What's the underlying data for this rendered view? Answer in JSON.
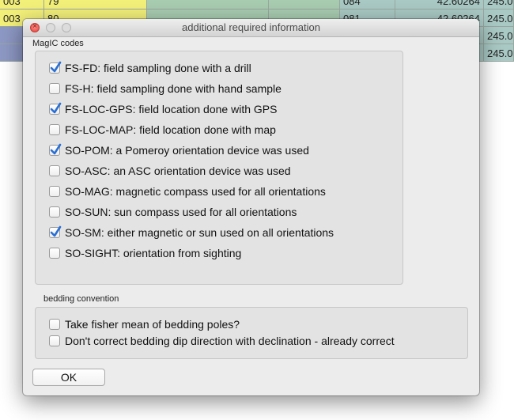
{
  "background_table": {
    "rows": [
      [
        "003",
        "79",
        "",
        "",
        "084",
        "42.60264",
        "245.0"
      ],
      [
        "003",
        "80",
        "",
        "",
        "081",
        "42.60264",
        "245.0"
      ],
      [
        "",
        "",
        "",
        "",
        "",
        "",
        "245.0"
      ],
      [
        "",
        "",
        "",
        "",
        "",
        "",
        "245.0"
      ]
    ]
  },
  "dialog": {
    "title": "additional required information",
    "magic_codes": {
      "legend": "MagIC codes",
      "options": [
        {
          "label": "FS-FD: field sampling done with a drill",
          "checked": true
        },
        {
          "label": "FS-H: field sampling done with hand sample",
          "checked": false
        },
        {
          "label": "FS-LOC-GPS: field location done with GPS",
          "checked": true
        },
        {
          "label": "FS-LOC-MAP:  field location done with map",
          "checked": false
        },
        {
          "label": "SO-POM:  a Pomeroy orientation device was used",
          "checked": true
        },
        {
          "label": "SO-ASC:  an ASC orientation device was used",
          "checked": false
        },
        {
          "label": "SO-MAG: magnetic compass used for all orientations",
          "checked": false
        },
        {
          "label": "SO-SUN: sun compass used for all orientations",
          "checked": false
        },
        {
          "label": "SO-SM: either magnetic or sun used on all orientations",
          "checked": true
        },
        {
          "label": "SO-SIGHT: orientation from sighting",
          "checked": false
        }
      ]
    },
    "bedding": {
      "legend": "bedding convention",
      "options": [
        {
          "label": "Take fisher mean of bedding poles?",
          "checked": false
        },
        {
          "label": "Don't correct bedding dip direction with declination - already correct",
          "checked": false
        }
      ]
    },
    "ok_label": "OK"
  },
  "colors": {
    "checkmark": "#2a6fd6",
    "close_button": "#e0443e"
  }
}
